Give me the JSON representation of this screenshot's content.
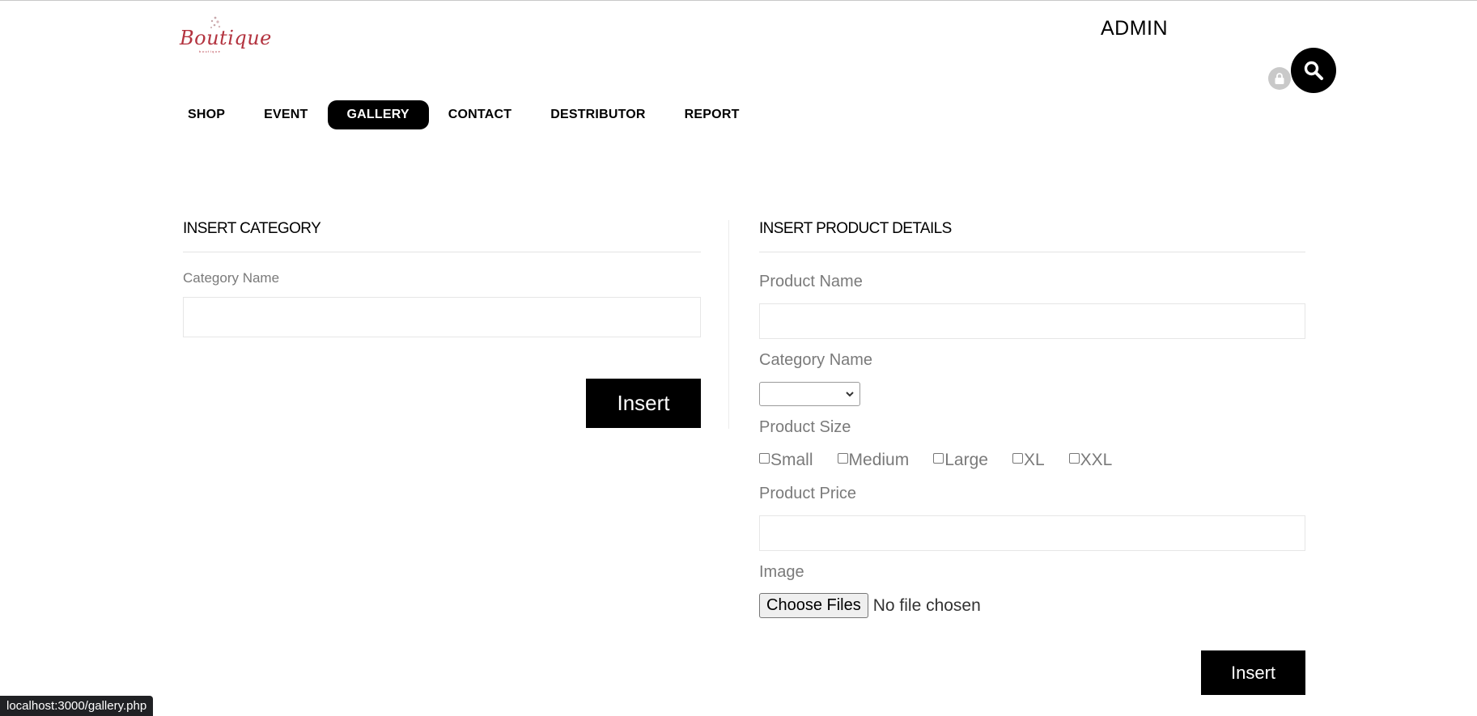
{
  "brand": {
    "logo_text": "Boutique",
    "logo_sub": "boutique"
  },
  "header": {
    "admin_label": "ADMIN"
  },
  "icons": {
    "lock": "lock-icon",
    "search": "search-icon",
    "chevron": "chevron-down-icon"
  },
  "nav": {
    "items": [
      {
        "label": "SHOP"
      },
      {
        "label": "EVENT"
      },
      {
        "label": "GALLERY",
        "active": true
      },
      {
        "label": "CONTACT"
      },
      {
        "label": "DESTRIBUTOR"
      },
      {
        "label": "REPORT"
      }
    ]
  },
  "category_form": {
    "title": "INSERT CATEGORY",
    "name_label": "Category Name",
    "name_value": "",
    "submit_label": "Insert"
  },
  "product_form": {
    "title": "INSERT PRODUCT DETAILS",
    "name_label": "Product Name",
    "name_value": "",
    "category_label": "Category Name",
    "category_selected": "",
    "size_label": "Product Size",
    "sizes": [
      {
        "label": "Small",
        "checked": false
      },
      {
        "label": "Medium",
        "checked": false
      },
      {
        "label": "Large",
        "checked": false
      },
      {
        "label": "XL",
        "checked": false
      },
      {
        "label": "XXL",
        "checked": false
      }
    ],
    "price_label": "Product Price",
    "price_value": "",
    "image_label": "Image",
    "file_button": "Choose Files",
    "file_status": "No file chosen",
    "submit_label": "Insert"
  },
  "colors": {
    "accent": "#000000",
    "brand": "#b3333f",
    "label": "#7a7a7a"
  },
  "statusbar": {
    "url": "localhost:3000/gallery.php"
  }
}
